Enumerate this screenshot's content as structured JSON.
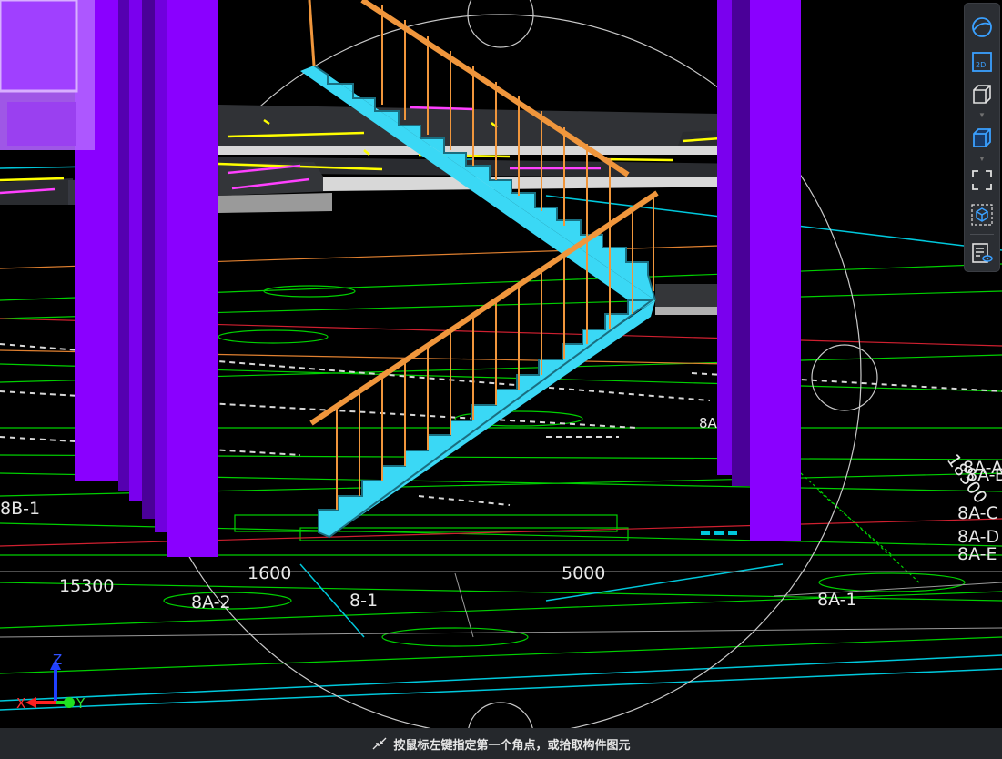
{
  "toolbar": {
    "buttons": [
      {
        "name": "orbit-view-button",
        "icon": "orbit-icon"
      },
      {
        "name": "2d-view-button",
        "icon": "2d-icon",
        "label": "2D"
      },
      {
        "name": "3d-box-view-button",
        "icon": "cube-outline-icon"
      },
      {
        "name": "3d-solid-view-button",
        "icon": "cube-blue-icon"
      },
      {
        "name": "zoom-extents-button",
        "icon": "fullscreen-corners-icon"
      },
      {
        "name": "local-3d-button",
        "icon": "cube-dashed-icon"
      },
      {
        "name": "view-list-button",
        "icon": "list-eye-icon"
      }
    ]
  },
  "viewport": {
    "dimension_labels": {
      "d15300": "15300",
      "d1600": "1600",
      "d5000": "5000",
      "d18300": "18300"
    },
    "axis_labels": {
      "a8a2": "8A-2",
      "a8_1": "8-1",
      "a8a1": "8A-1",
      "a8b1": "8B-1",
      "a8aa": "8A-A",
      "a8ab": "8A-B",
      "a8ac": "8A-C",
      "a8ad": "8A-D",
      "a8ae": "8A-E",
      "a8a_partial": "8A"
    }
  },
  "gizmo": {
    "x": "X",
    "y": "Y",
    "z": "Z"
  },
  "colors": {
    "column": "#8a00ff",
    "stair": "#3ad8f5",
    "railing": "#f0963c",
    "slab": "#3a3c40",
    "grid_line": "#00e000",
    "cyan_line": "#00c8dc",
    "yellow": "#ffff00",
    "magenta": "#ff40ff"
  },
  "status": {
    "message": "按鼠标左键指定第一个角点，或拾取构件图元",
    "icon": "crosshair-corner-icon"
  }
}
